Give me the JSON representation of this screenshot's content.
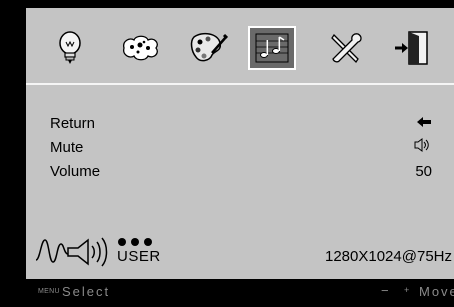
{
  "menu_icons": [
    {
      "name": "brightness-bulb-icon",
      "selected": false
    },
    {
      "name": "image-settings-icon",
      "selected": false
    },
    {
      "name": "color-palette-icon",
      "selected": false
    },
    {
      "name": "music-notes-icon",
      "selected": true
    },
    {
      "name": "tools-icon",
      "selected": false
    },
    {
      "name": "exit-door-icon",
      "selected": false
    }
  ],
  "items": [
    {
      "label": "Return",
      "value": "",
      "value_icon": "back-arrow-icon"
    },
    {
      "label": "Mute",
      "value": "",
      "value_icon": "speaker-icon"
    },
    {
      "label": "Volume",
      "value": "50",
      "value_icon": ""
    }
  ],
  "status": {
    "mode": "USER",
    "resolution": "1280X1024@75Hz"
  },
  "footer": {
    "menu_key": "MENU",
    "select": "Select",
    "minus_key": "−",
    "plus_key": "+",
    "move": "Move"
  },
  "colors": {
    "panel": "#c4c4c4",
    "background": "#000000",
    "footer_text": "#8a8a8a",
    "selected_icon_fill": "#6a6a6a"
  }
}
